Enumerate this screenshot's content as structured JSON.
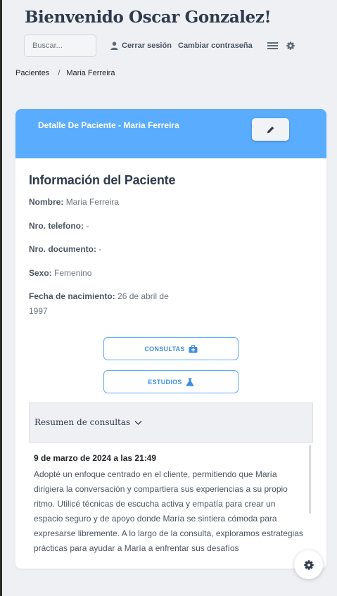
{
  "header": {
    "welcome": "Bienvenido Oscar Gonzalez!",
    "search_placeholder": "Buscar...",
    "logout_label": "Cerrar sesión",
    "change_password_label": "Cambiar contraseña"
  },
  "breadcrumb": {
    "root": "Pacientes",
    "separator": "/",
    "current": "Maria Ferreira"
  },
  "card": {
    "title": "Detalle De Paciente - Maria Ferreira",
    "section_title": "Información del Paciente",
    "fields": [
      {
        "label": "Nombre:",
        "value": "Maria Ferreira"
      },
      {
        "label": "Nro. telefono:",
        "value": "-"
      },
      {
        "label": "Nro. documento:",
        "value": "-"
      },
      {
        "label": "Sexo:",
        "value": "Femenino"
      },
      {
        "label": "Fecha de nacimiento:",
        "value": "26 de abril de 1997"
      }
    ],
    "consultas_label": "CONSULTAS",
    "estudios_label": "ESTUDIOS",
    "summary_label": "Resumen de consultas",
    "consultations": [
      {
        "date": "9 de marzo de 2024 a las 21:49",
        "text": "Adopté un enfoque centrado en el cliente, permitiendo que María dirigiera la conversación y compartiera sus experiencias a su propio ritmo. Utilicé técnicas de escucha activa y empatía para crear un espacio seguro y de apoyo donde María se sintiera cómoda para expresarse libremente. A lo largo de la consulta, exploramos estrategias prácticas para ayudar a María a enfrentar sus desafíos"
      }
    ]
  },
  "icons": {
    "user": "user-icon",
    "menu": "hamburger-menu-icon",
    "settings": "gear-icon",
    "edit": "pencil-icon",
    "consultas": "medical-kit-icon",
    "estudios": "flask-icon",
    "chevron": "chevron-down-icon",
    "fab": "gear-icon"
  },
  "colors": {
    "accent": "#5aacff",
    "accent_text": "#3d8ee0",
    "background": "#eef0f4",
    "title": "#2f3b4c"
  }
}
